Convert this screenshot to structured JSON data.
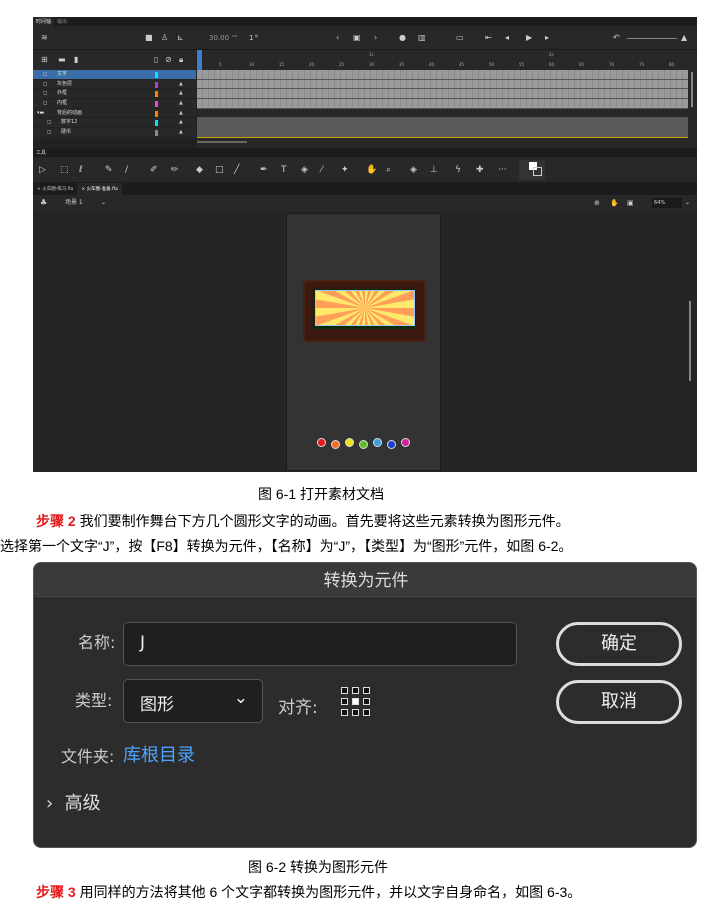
{
  "figure1": {
    "panel_tabs": [
      "时间轴",
      "输出"
    ],
    "fps": "30.00",
    "fps_unit": "FPS",
    "frame": "1",
    "frame_unit": "帧",
    "ruler_ticks": [
      "5",
      "10",
      "15",
      "20",
      "25",
      "30",
      "35",
      "40",
      "45",
      "50",
      "55",
      "60",
      "65",
      "70",
      "75",
      "80"
    ],
    "ruler_seconds": [
      "1s",
      "2s"
    ],
    "layers": [
      {
        "name": "文字",
        "color": "#00e5ff",
        "locked": false,
        "selected": true
      },
      {
        "name": "灰色层",
        "color": "#b13fd6",
        "locked": true
      },
      {
        "name": "外框",
        "color": "#ff8000",
        "locked": true
      },
      {
        "name": "内框",
        "color": "#ff3fd0",
        "locked": true
      },
      {
        "name": "背后的动画",
        "color": "#ff8000",
        "locked": true,
        "folder": true
      },
      {
        "name": "数字12",
        "color": "#00e5ff",
        "locked": true
      },
      {
        "name": "硬币",
        "color": "#888888",
        "locked": true
      }
    ],
    "tools_title": "工具",
    "file_tabs": [
      "火车圈-练习.fla",
      "火车圈-准备.fla"
    ],
    "scene": "场景 1",
    "zoom": "64%",
    "caption": "图 6-1 打开素材文档"
  },
  "step2": {
    "label": "步骤 2",
    "line1": " 我们要制作舞台下方几个圆形文字的动画。首先要将这些元素转换为图形元件。",
    "line2": "选择第一个文字“J”，按【F8】转换为元件，【名称】为“J”，【类型】为“图形”元件，如图 6-2。"
  },
  "dialog": {
    "title": "转换为元件",
    "name_label": "名称:",
    "name_value": "J",
    "type_label": "类型:",
    "type_value": "图形",
    "align_label": "对齐:",
    "folder_label": "文件夹:",
    "folder_value": "库根目录",
    "advanced": "高级",
    "ok": "确定",
    "cancel": "取消",
    "accent": "#4da3ff"
  },
  "caption2": "图 6-2 转换为图形元件",
  "step3": {
    "label": "步骤 3",
    "text": " 用同样的方法将其他 6 个文字都转换为图形元件，并以文字自身命名，如图 6-3。"
  }
}
